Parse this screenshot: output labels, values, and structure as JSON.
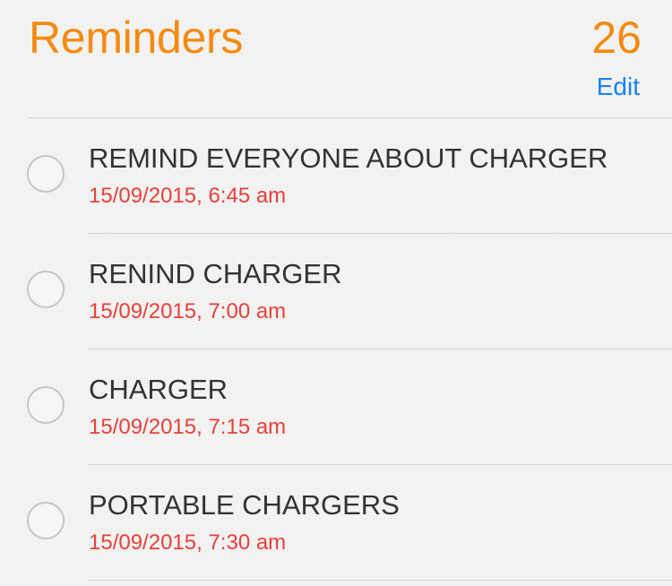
{
  "header": {
    "title": "Reminders",
    "count": "26",
    "edit_label": "Edit"
  },
  "reminders": [
    {
      "title": "REMIND EVERYONE ABOUT CHARGER",
      "date": "15/09/2015, 6:45 am"
    },
    {
      "title": "RENIND CHARGER",
      "date": "15/09/2015, 7:00 am"
    },
    {
      "title": "CHARGER",
      "date": "15/09/2015, 7:15 am"
    },
    {
      "title": "PORTABLE CHARGERS",
      "date": "15/09/2015, 7:30 am"
    }
  ],
  "colors": {
    "title_accent": "#f58a12",
    "edit_link": "#1a82f0",
    "date_text": "#e8403a",
    "background": "#f4f4f3"
  },
  "icons": {
    "checkbox": "empty-circle-checkbox-icon"
  }
}
